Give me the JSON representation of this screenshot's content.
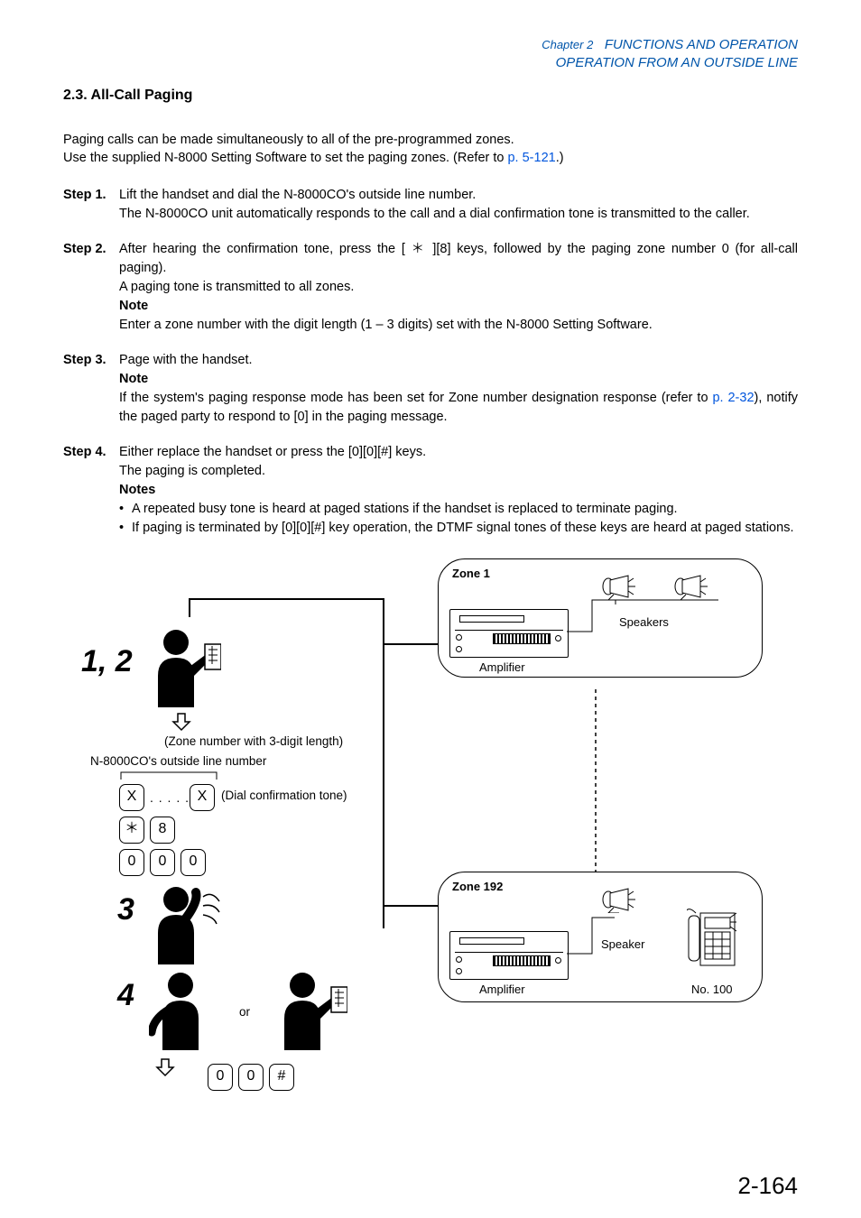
{
  "header": {
    "chapter": "Chapter 2",
    "chapter_title": "FUNCTIONS AND OPERATION",
    "subtitle": "OPERATION FROM AN OUTSIDE LINE"
  },
  "section": {
    "number_title": "2.3. All-Call Paging"
  },
  "intro": {
    "line1": "Paging calls can be made simultaneously to all of the pre-programmed zones.",
    "line2_a": "Use the supplied N-8000 Setting Software to set the paging zones. (Refer to ",
    "line2_link": "p. 5-121",
    "line2_b": ".)"
  },
  "steps": {
    "s1": {
      "label": "Step 1.",
      "p1": "Lift the handset and dial the N-8000CO's outside line number.",
      "p2": "The N-8000CO unit automatically responds to the call and a dial confirmation tone is transmitted to the caller."
    },
    "s2": {
      "label": "Step 2.",
      "p1": "After hearing the confirmation tone, press the [ ＊ ][8] keys, followed by the paging zone number 0 (for all-call paging).",
      "p2": "A paging tone is transmitted to all zones.",
      "note_label": "Note",
      "p3": "Enter a zone number with the digit length (1 – 3 digits) set with the N-8000 Setting Software."
    },
    "s3": {
      "label": "Step 3.",
      "p1": "Page with the handset.",
      "note_label": "Note",
      "p2a": "If the system's paging response mode has been set for Zone number designation response (refer to ",
      "p2link": "p. 2-32",
      "p2b": "), notify the paged party to respond to [0] in the paging message."
    },
    "s4": {
      "label": "Step 4.",
      "p1": "Either replace the handset or press the [0][0][#] keys.",
      "p2": "The paging is completed.",
      "notes_label": "Notes",
      "b1": "A repeated busy tone is heard at paged stations if the handset is replaced to terminate paging.",
      "b2": "If paging is terminated by [0][0][#] key operation, the DTMF signal tones of these keys are heard at paged stations."
    }
  },
  "diagram": {
    "big12": "1, 2",
    "big3": "3",
    "big4": "4",
    "zone_note": "(Zone number with 3-digit length)",
    "outside_label": "N-8000CO's outside line number",
    "dial_tone": "(Dial confirmation tone)",
    "or": "or",
    "zone1": {
      "title": "Zone 1",
      "amp": "Amplifier",
      "speakers": "Speakers"
    },
    "zone192": {
      "title": "Zone 192",
      "amp": "Amplifier",
      "speaker": "Speaker",
      "station": "No. 100"
    },
    "keys": {
      "x": "X",
      "star": "＊",
      "eight": "8",
      "zero": "0",
      "hash": "#"
    }
  },
  "page_number": "2-164"
}
